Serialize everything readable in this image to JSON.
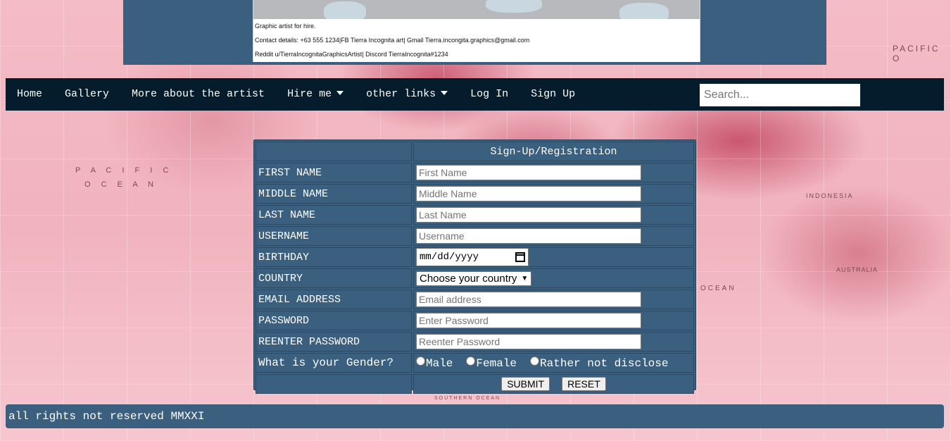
{
  "map_labels": {
    "pacific_left_1": "P A C I F I C",
    "pacific_left_2": "O C E A N",
    "pacific_right": "PACIFIC O",
    "indonesia": "INDONESIA",
    "australia": "AUSTRALIA",
    "ocean": "OCEAN",
    "southern_ocean": "SOUTHERN OCEAN"
  },
  "banner": {
    "line1": "Graphic artist for hire.",
    "line2": "Contact details: +63 555 1234|FB Tierra Incognita art| Gmail Tierra.incongita.graphics@gmail.com",
    "line3": "Reddit u/TierraIncognitaGraphicsArtist| Discord TierraIncognita#1234"
  },
  "nav": {
    "items": [
      {
        "label": "Home"
      },
      {
        "label": "Gallery"
      },
      {
        "label": "More about the artist"
      },
      {
        "label": "Hire me",
        "dropdown": true
      },
      {
        "label": "other links",
        "dropdown": true
      },
      {
        "label": "Log In"
      },
      {
        "label": "Sign Up"
      }
    ],
    "search_placeholder": "Search..."
  },
  "form": {
    "title": "Sign-Up/Registration",
    "fields": {
      "first_name": {
        "label": "FIRST NAME",
        "placeholder": "First Name"
      },
      "middle_name": {
        "label": "MIDDLE NAME",
        "placeholder": "Middle Name"
      },
      "last_name": {
        "label": "LAST NAME",
        "placeholder": "Last Name"
      },
      "username": {
        "label": "USERNAME",
        "placeholder": "Username"
      },
      "birthday": {
        "label": "BIRTHDAY",
        "value": "mm/dd/yyyy"
      },
      "country": {
        "label": "COUNTRY",
        "value": "Choose your country"
      },
      "email": {
        "label": "EMAIL ADDRESS",
        "placeholder": "Email address"
      },
      "password": {
        "label": "PASSWORD",
        "placeholder": "Enter Password"
      },
      "reenter_password": {
        "label": "REENTER PASSWORD",
        "placeholder": "Reenter Password"
      },
      "gender": {
        "label": "What is your Gender?",
        "options": [
          "Male",
          "Female",
          "Rather not disclose"
        ]
      }
    },
    "submit_label": "SUBMIT",
    "reset_label": "RESET"
  },
  "footer": {
    "text": "all rights not reserved MMXXI"
  },
  "colors": {
    "nav_bg": "#041c2c",
    "panel_bg": "#3b5f7e",
    "map_pink": "#f4bcc6"
  }
}
